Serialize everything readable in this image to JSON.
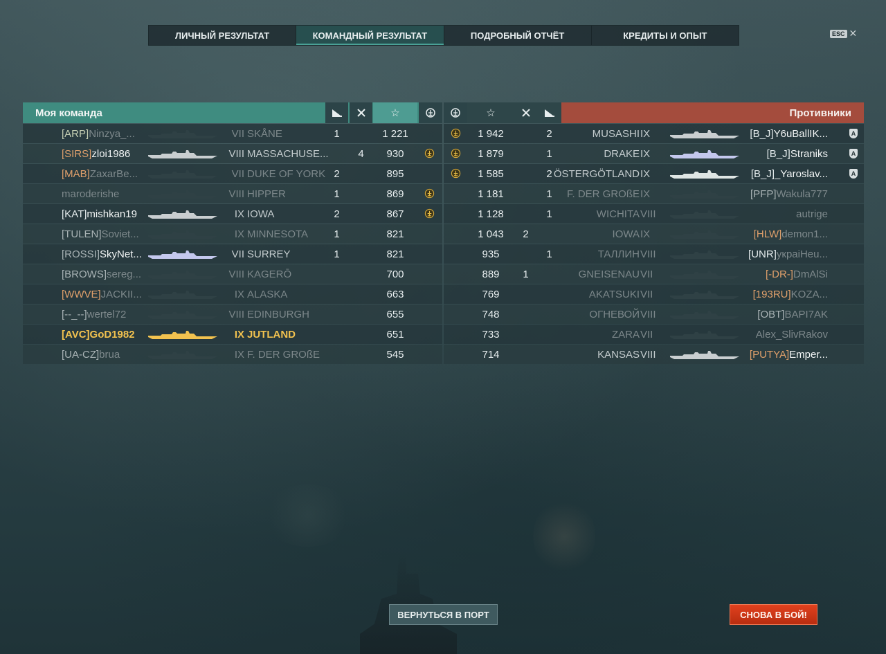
{
  "tabs": [
    "ЛИЧНЫЙ РЕЗУЛЬТАТ",
    "КОМАНДНЫЙ РЕЗУЛЬТАТ",
    "ПОДРОБНЫЙ ОТЧЁТ",
    "КРЕДИТЫ И ОПЫТ"
  ],
  "active_tab": 1,
  "esc": {
    "key": "ESC",
    "close": "✕"
  },
  "header": {
    "my_team": "Моя команда",
    "enemies": "Противники",
    "star": "☆"
  },
  "icons": [
    "ship-sunk-icon",
    "plane-kill-icon",
    "base-xp-star-icon",
    "achievement-icon",
    "division-icon"
  ],
  "colors": {
    "ally_header": "#3f8c80",
    "enemy_header": "#a44c3d",
    "player_highlight": "#f2c24f",
    "return_button": "#3f5a5f",
    "battle_button": "#d23a18"
  },
  "my_team": [
    {
      "clan": "[ARP]",
      "name": "Ninzya_...",
      "tier": "VII",
      "ship": "SKÅNE",
      "kills": "1",
      "planes": "",
      "xp": "1 221",
      "medal": false,
      "dim": true,
      "clan_color": "green",
      "ship_color": "#2f4145"
    },
    {
      "clan": "[SIRS]",
      "name": "zloi1986",
      "tier": "VIII",
      "ship": "MASSACHUSE...",
      "kills": "",
      "planes": "4",
      "xp": "930",
      "medal": true,
      "dim": false,
      "clan_color": "orange",
      "ship_color": "#c9ced0"
    },
    {
      "clan": "[MAB]",
      "name": "ZaxarBe...",
      "tier": "VII",
      "ship": "DUKE OF YORK",
      "kills": "2",
      "planes": "",
      "xp": "895",
      "medal": false,
      "dim": true,
      "clan_color": "orange",
      "ship_color": "#2f4145"
    },
    {
      "clan": "",
      "name": "maroderishe",
      "tier": "VIII",
      "ship": "HIPPER",
      "kills": "1",
      "planes": "",
      "xp": "869",
      "medal": true,
      "dim": true,
      "clan_color": "grey",
      "ship_color": "#2f4145"
    },
    {
      "clan": "[KAT]",
      "name": "mishkan19",
      "tier": "IX",
      "ship": "IOWA",
      "kills": "2",
      "planes": "",
      "xp": "867",
      "medal": true,
      "dim": false,
      "clan_color": "white",
      "ship_color": "#c9ced0"
    },
    {
      "clan": "[TULEN]",
      "name": "Soviet...",
      "tier": "IX",
      "ship": "MINNESOTA",
      "kills": "1",
      "planes": "",
      "xp": "821",
      "medal": false,
      "dim": true,
      "clan_color": "grey",
      "ship_color": "#2f4145"
    },
    {
      "clan": "[ROSSI]",
      "name": "SkyNet...",
      "tier": "VII",
      "ship": "SURREY",
      "kills": "1",
      "planes": "",
      "xp": "821",
      "medal": false,
      "dim": false,
      "clan_color": "grey",
      "ship_color": "#c4c8ee"
    },
    {
      "clan": "[BROWS]",
      "name": "sereg...",
      "tier": "VIII",
      "ship": "KAGERŌ",
      "kills": "",
      "planes": "",
      "xp": "700",
      "medal": false,
      "dim": true,
      "clan_color": "grey",
      "ship_color": "#2f4145"
    },
    {
      "clan": "[WWVE]",
      "name": "JACKII...",
      "tier": "IX",
      "ship": "ALASKA",
      "kills": "",
      "planes": "",
      "xp": "663",
      "medal": false,
      "dim": true,
      "clan_color": "orange",
      "ship_color": "#2f4145"
    },
    {
      "clan": "[--_--]",
      "name": "wertel72",
      "tier": "VIII",
      "ship": "EDINBURGH",
      "kills": "",
      "planes": "",
      "xp": "655",
      "medal": false,
      "dim": true,
      "clan_color": "grey",
      "ship_color": "#2f4145"
    },
    {
      "clan": "[AVC]",
      "name": "GoD1982",
      "tier": "IX",
      "ship": "JUTLAND",
      "kills": "",
      "planes": "",
      "xp": "651",
      "medal": false,
      "dim": false,
      "me": true,
      "clan_color": "yellow",
      "ship_color": "#f2c24f"
    },
    {
      "clan": "[UA-CZ]",
      "name": "brua",
      "tier": "IX",
      "ship": "F. DER GROßE",
      "kills": "",
      "planes": "",
      "xp": "545",
      "medal": false,
      "dim": true,
      "clan_color": "grey",
      "ship_color": "#2f4145"
    }
  ],
  "enemies": [
    {
      "medal": true,
      "xp": "1 942",
      "planes": "",
      "kills": "2",
      "ship": "MUSASHI",
      "tier": "IX",
      "clan": "[B_J]",
      "name": "Y6uBallIK...",
      "division": true,
      "dim": false,
      "clan_color": "white",
      "ship_color": "#c9ced0"
    },
    {
      "medal": true,
      "xp": "1 879",
      "planes": "",
      "kills": "1",
      "ship": "DRAKE",
      "tier": "IX",
      "clan": "[B_J]",
      "name": "Straniks",
      "division": true,
      "dim": false,
      "clan_color": "white",
      "ship_color": "#c4c8ee"
    },
    {
      "medal": true,
      "xp": "1 585",
      "planes": "",
      "kills": "2",
      "ship": "ÖSTERGÖTLAND",
      "tier": "IX",
      "clan": "[B_J]",
      "name": "_Yaroslav...",
      "division": true,
      "dim": false,
      "clan_color": "white",
      "ship_color": "#dfe6e4"
    },
    {
      "medal": false,
      "xp": "1 181",
      "planes": "",
      "kills": "1",
      "ship": "F. DER GROßE",
      "tier": "IX",
      "clan": "[PFP]",
      "name": "Wakula777",
      "division": false,
      "dim": true,
      "clan_color": "grey",
      "ship_color": "#2f4145"
    },
    {
      "medal": false,
      "xp": "1 128",
      "planes": "",
      "kills": "1",
      "ship": "WICHITA",
      "tier": "VIII",
      "clan": "",
      "name": "autrige",
      "division": false,
      "dim": true,
      "clan_color": "grey",
      "ship_color": "#2f4145"
    },
    {
      "medal": false,
      "xp": "1 043",
      "planes": "2",
      "kills": "",
      "ship": "IOWA",
      "tier": "IX",
      "clan": "[HLW]",
      "name": "demon1...",
      "division": false,
      "dim": true,
      "clan_color": "orange",
      "ship_color": "#2f4145"
    },
    {
      "medal": false,
      "xp": "935",
      "planes": "",
      "kills": "1",
      "ship": "ТАЛЛИН",
      "tier": "VIII",
      "clan": "[UNR]",
      "name": "укpaiHeu...",
      "division": false,
      "dim": true,
      "clan_color": "white",
      "ship_color": "#2f4145"
    },
    {
      "medal": false,
      "xp": "889",
      "planes": "1",
      "kills": "",
      "ship": "GNEISENAU",
      "tier": "VII",
      "clan": "[-DR-]",
      "name": "DmAlSi",
      "division": false,
      "dim": true,
      "clan_color": "orange",
      "ship_color": "#2f4145"
    },
    {
      "medal": false,
      "xp": "769",
      "planes": "",
      "kills": "",
      "ship": "AKATSUKI",
      "tier": "VII",
      "clan": "[193RU]",
      "name": "KOZA...",
      "division": false,
      "dim": true,
      "clan_color": "orange",
      "ship_color": "#2f4145"
    },
    {
      "medal": false,
      "xp": "748",
      "planes": "",
      "kills": "",
      "ship": "ОГНЕВОЙ",
      "tier": "VIII",
      "clan": "[OBT]",
      "name": "BAPI7AK",
      "division": false,
      "dim": true,
      "clan_color": "grey",
      "ship_color": "#2f4145"
    },
    {
      "medal": false,
      "xp": "733",
      "planes": "",
      "kills": "",
      "ship": "ZARA",
      "tier": "VII",
      "clan": "",
      "name": "Alex_SlivRakov",
      "division": false,
      "dim": true,
      "clan_color": "grey",
      "ship_color": "#2f4145"
    },
    {
      "medal": false,
      "xp": "714",
      "planes": "",
      "kills": "",
      "ship": "KANSAS",
      "tier": "VIII",
      "clan": "[PUTYA]",
      "name": "Emper...",
      "division": false,
      "dim": false,
      "clan_color": "orange",
      "ship_color": "#c9ced0"
    }
  ],
  "division_mark": "A",
  "buttons": {
    "return_port": "ВЕРНУТЬСЯ В ПОРТ",
    "battle_again": "СНОВА В БОЙ!"
  }
}
